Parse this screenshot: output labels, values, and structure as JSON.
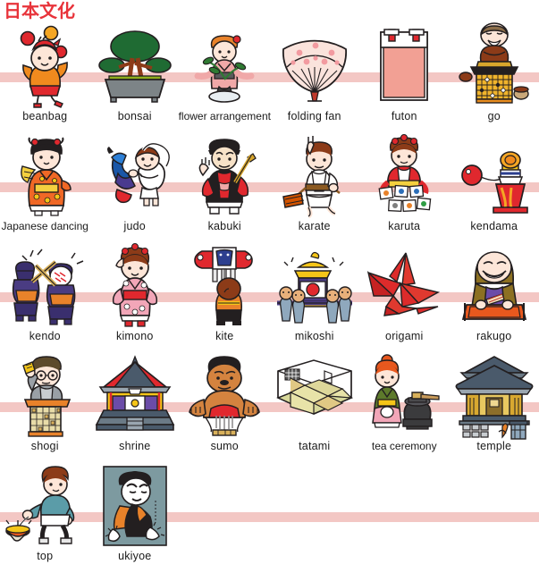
{
  "title": "日本文化",
  "colors": {
    "title": "#e8333a",
    "stripe": "#f3c7c4",
    "label": "#1a1a1a",
    "background": "#ffffff"
  },
  "chart_data": {
    "type": "table",
    "title": "日本文化",
    "columns": 6,
    "rows": 5,
    "items": [
      "beanbag",
      "bonsai",
      "flower arrangement",
      "folding fan",
      "futon",
      "go",
      "Japanese dancing",
      "judo",
      "kabuki",
      "karate",
      "karuta",
      "kendama",
      "kendo",
      "kimono",
      "kite",
      "mikoshi",
      "origami",
      "rakugo",
      "shogi",
      "shrine",
      "sumo",
      "tatami",
      "tea ceremony",
      "temple",
      "top",
      "ukiyoe"
    ]
  },
  "rows": [
    {
      "index": 1,
      "cells": [
        {
          "label": "beanbag",
          "icon": "beanbag-illustration"
        },
        {
          "label": "bonsai",
          "icon": "bonsai-illustration"
        },
        {
          "label": "flower arrangement",
          "icon": "flower-arrangement-illustration"
        },
        {
          "label": "folding fan",
          "icon": "folding-fan-illustration"
        },
        {
          "label": "futon",
          "icon": "futon-illustration"
        },
        {
          "label": "go",
          "icon": "go-illustration"
        }
      ]
    },
    {
      "index": 2,
      "cells": [
        {
          "label": "Japanese dancing",
          "icon": "japanese-dancing-illustration"
        },
        {
          "label": "judo",
          "icon": "judo-illustration"
        },
        {
          "label": "kabuki",
          "icon": "kabuki-illustration"
        },
        {
          "label": "karate",
          "icon": "karate-illustration"
        },
        {
          "label": "karuta",
          "icon": "karuta-illustration"
        },
        {
          "label": "kendama",
          "icon": "kendama-illustration"
        }
      ]
    },
    {
      "index": 3,
      "cells": [
        {
          "label": "kendo",
          "icon": "kendo-illustration"
        },
        {
          "label": "kimono",
          "icon": "kimono-illustration"
        },
        {
          "label": "kite",
          "icon": "kite-illustration"
        },
        {
          "label": "mikoshi",
          "icon": "mikoshi-illustration"
        },
        {
          "label": "origami",
          "icon": "origami-illustration"
        },
        {
          "label": "rakugo",
          "icon": "rakugo-illustration"
        }
      ]
    },
    {
      "index": 4,
      "cells": [
        {
          "label": "shogi",
          "icon": "shogi-illustration"
        },
        {
          "label": "shrine",
          "icon": "shrine-illustration"
        },
        {
          "label": "sumo",
          "icon": "sumo-illustration"
        },
        {
          "label": "tatami",
          "icon": "tatami-illustration"
        },
        {
          "label": "tea ceremony",
          "icon": "tea-ceremony-illustration"
        },
        {
          "label": "temple",
          "icon": "temple-illustration"
        }
      ]
    },
    {
      "index": 5,
      "cells": [
        {
          "label": "top",
          "icon": "top-illustration"
        },
        {
          "label": "ukiyoe",
          "icon": "ukiyoe-illustration"
        }
      ]
    }
  ]
}
